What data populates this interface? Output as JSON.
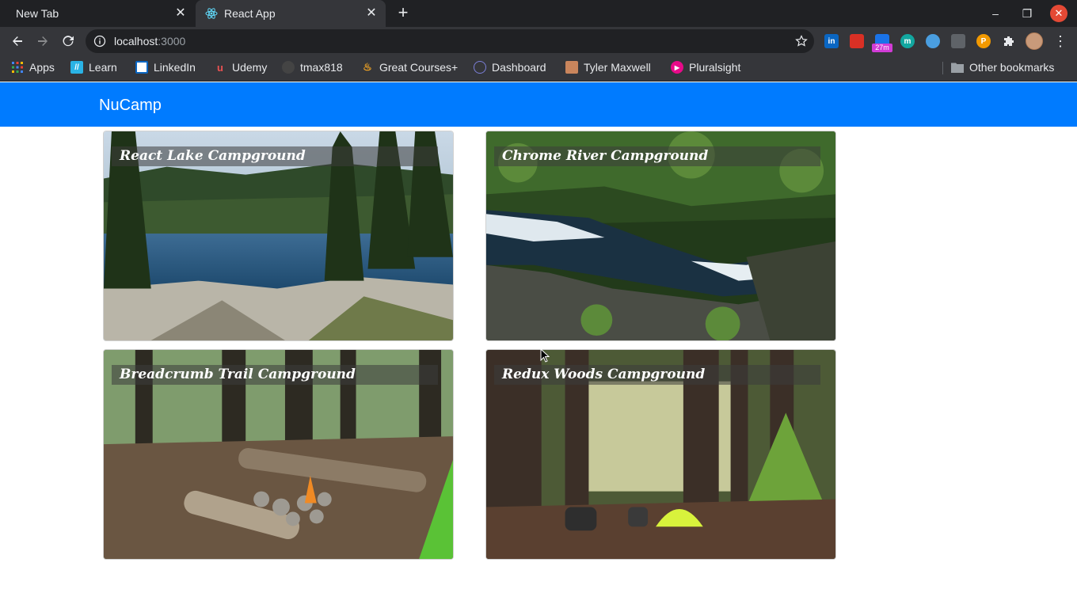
{
  "browser": {
    "tabs": [
      {
        "title": "New Tab",
        "active": false
      },
      {
        "title": "React App",
        "active": true
      }
    ],
    "address": {
      "host": "localhost",
      "port": ":3000"
    },
    "extensions": [
      {
        "name": "linkedin-extension-icon",
        "label": "in",
        "color": "#0a66c2"
      },
      {
        "name": "red-extension-icon",
        "label": "",
        "color": "#d93025"
      },
      {
        "name": "blue-extension-icon",
        "label": "",
        "color": "#1a73e8",
        "badge": "27m"
      },
      {
        "name": "teal-extension-icon",
        "label": "m",
        "color": "#12a7a0"
      },
      {
        "name": "blue-circle-extension-icon",
        "label": "",
        "color": "#4a9ee0"
      },
      {
        "name": "camera-extension-icon",
        "label": "",
        "color": "#5f6368"
      },
      {
        "name": "orange-extension-icon",
        "label": "P",
        "color": "#f29900"
      }
    ],
    "bookmarks": [
      {
        "label": "Apps",
        "icon": "apps-grid-icon"
      },
      {
        "label": "Learn",
        "icon": "learn-icon"
      },
      {
        "label": "LinkedIn",
        "icon": "linkedin-icon"
      },
      {
        "label": "Udemy",
        "icon": "udemy-icon"
      },
      {
        "label": "tmax818",
        "icon": "github-icon"
      },
      {
        "label": "Great Courses+",
        "icon": "flame-icon"
      },
      {
        "label": "Dashboard",
        "icon": "dashboard-icon"
      },
      {
        "label": "Tyler Maxwell",
        "icon": "profile-icon"
      },
      {
        "label": "Pluralsight",
        "icon": "pluralsight-icon"
      }
    ],
    "other_bookmarks": "Other bookmarks"
  },
  "app": {
    "brand": "NuCamp",
    "brand_color": "#007bff",
    "campsites": [
      {
        "name": "React Lake Campground",
        "scene": "lake"
      },
      {
        "name": "Chrome River Campground",
        "scene": "river"
      },
      {
        "name": "Breadcrumb Trail Campground",
        "scene": "campfire"
      },
      {
        "name": "Redux Woods Campground",
        "scene": "woods"
      }
    ]
  }
}
